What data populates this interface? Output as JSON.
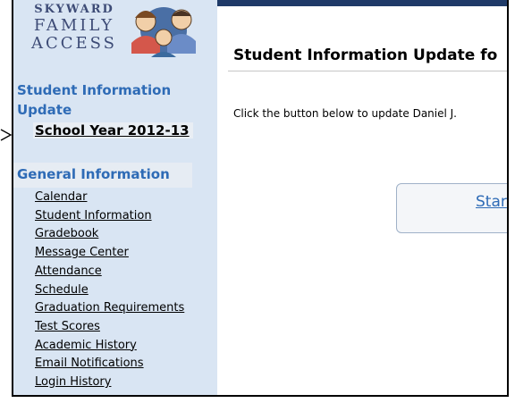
{
  "logo": {
    "line1": "SKYWARD",
    "line2": "FAMILY",
    "line3": "ACCESS"
  },
  "sidebar": {
    "section1_title": "Student Information Update",
    "school_year": "School Year 2012-13",
    "section2_title": "General Information",
    "items": [
      "Calendar",
      "Student Information",
      "Gradebook",
      "Message Center",
      "Attendance",
      "Schedule",
      "Graduation Requirements",
      "Test Scores",
      "Academic History",
      "Email Notifications",
      "Login History"
    ]
  },
  "main": {
    "title": "Student Information Update fo",
    "instruction": "Click the button below to update Daniel J.",
    "start_button": "Star"
  },
  "colors": {
    "link_blue": "#2e6bb6",
    "sidebar_bg": "#d9e5f3",
    "topbar": "#1f3a68"
  }
}
